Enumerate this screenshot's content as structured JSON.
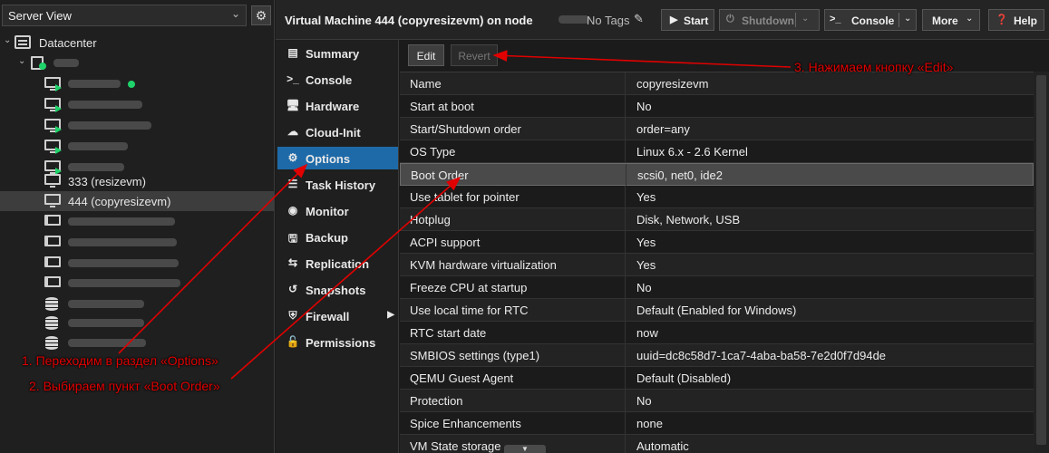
{
  "tree": {
    "view_label": "Server View",
    "datacenter": "Datacenter",
    "vm_333": "333 (resizevm)",
    "vm_444": "444 (copyresizevm)"
  },
  "topbar": {
    "title": "Virtual Machine 444 (copyresizevm) on node",
    "tags": "No Tags",
    "start": "Start",
    "shutdown": "Shutdown",
    "console": "Console",
    "more": "More",
    "help": "Help"
  },
  "nav": [
    {
      "label": "Summary",
      "icon": "book-icon"
    },
    {
      "label": "Console",
      "icon": "terminal-icon"
    },
    {
      "label": "Hardware",
      "icon": "desktop-icon"
    },
    {
      "label": "Cloud-Init",
      "icon": "cloud-icon"
    },
    {
      "label": "Options",
      "icon": "gear-icon"
    },
    {
      "label": "Task History",
      "icon": "list-icon"
    },
    {
      "label": "Monitor",
      "icon": "eye-icon"
    },
    {
      "label": "Backup",
      "icon": "floppy-icon"
    },
    {
      "label": "Replication",
      "icon": "retweet-icon"
    },
    {
      "label": "Snapshots",
      "icon": "history-icon"
    },
    {
      "label": "Firewall",
      "icon": "shield-icon"
    },
    {
      "label": "Permissions",
      "icon": "unlock-icon"
    }
  ],
  "grid": {
    "edit": "Edit",
    "revert": "Revert",
    "rows": [
      {
        "name": "Name",
        "value": "copyresizevm"
      },
      {
        "name": "Start at boot",
        "value": "No"
      },
      {
        "name": "Start/Shutdown order",
        "value": "order=any"
      },
      {
        "name": "OS Type",
        "value": "Linux 6.x - 2.6 Kernel"
      },
      {
        "name": "Boot Order",
        "value": "scsi0, net0, ide2"
      },
      {
        "name": "Use tablet for pointer",
        "value": "Yes"
      },
      {
        "name": "Hotplug",
        "value": "Disk, Network, USB"
      },
      {
        "name": "ACPI support",
        "value": "Yes"
      },
      {
        "name": "KVM hardware virtualization",
        "value": "Yes"
      },
      {
        "name": "Freeze CPU at startup",
        "value": "No"
      },
      {
        "name": "Use local time for RTC",
        "value": "Default (Enabled for Windows)"
      },
      {
        "name": "RTC start date",
        "value": "now"
      },
      {
        "name": "SMBIOS settings (type1)",
        "value": "uuid=dc8c58d7-1ca7-4aba-ba58-7e2d0f7d94de"
      },
      {
        "name": "QEMU Guest Agent",
        "value": "Default (Disabled)"
      },
      {
        "name": "Protection",
        "value": "No"
      },
      {
        "name": "Spice Enhancements",
        "value": "none"
      },
      {
        "name": "VM State storage",
        "value": "Automatic"
      }
    ]
  },
  "annotations": {
    "step1": "1. Переходим в раздел «Options»",
    "step2": "2. Выбираем пункт «Boot Order»",
    "step3": "3. Нажимаем кнопку «Edit»"
  },
  "colors": {
    "accent": "#1e6aa8",
    "annotation": "#e00000",
    "running": "#1fd36a"
  }
}
